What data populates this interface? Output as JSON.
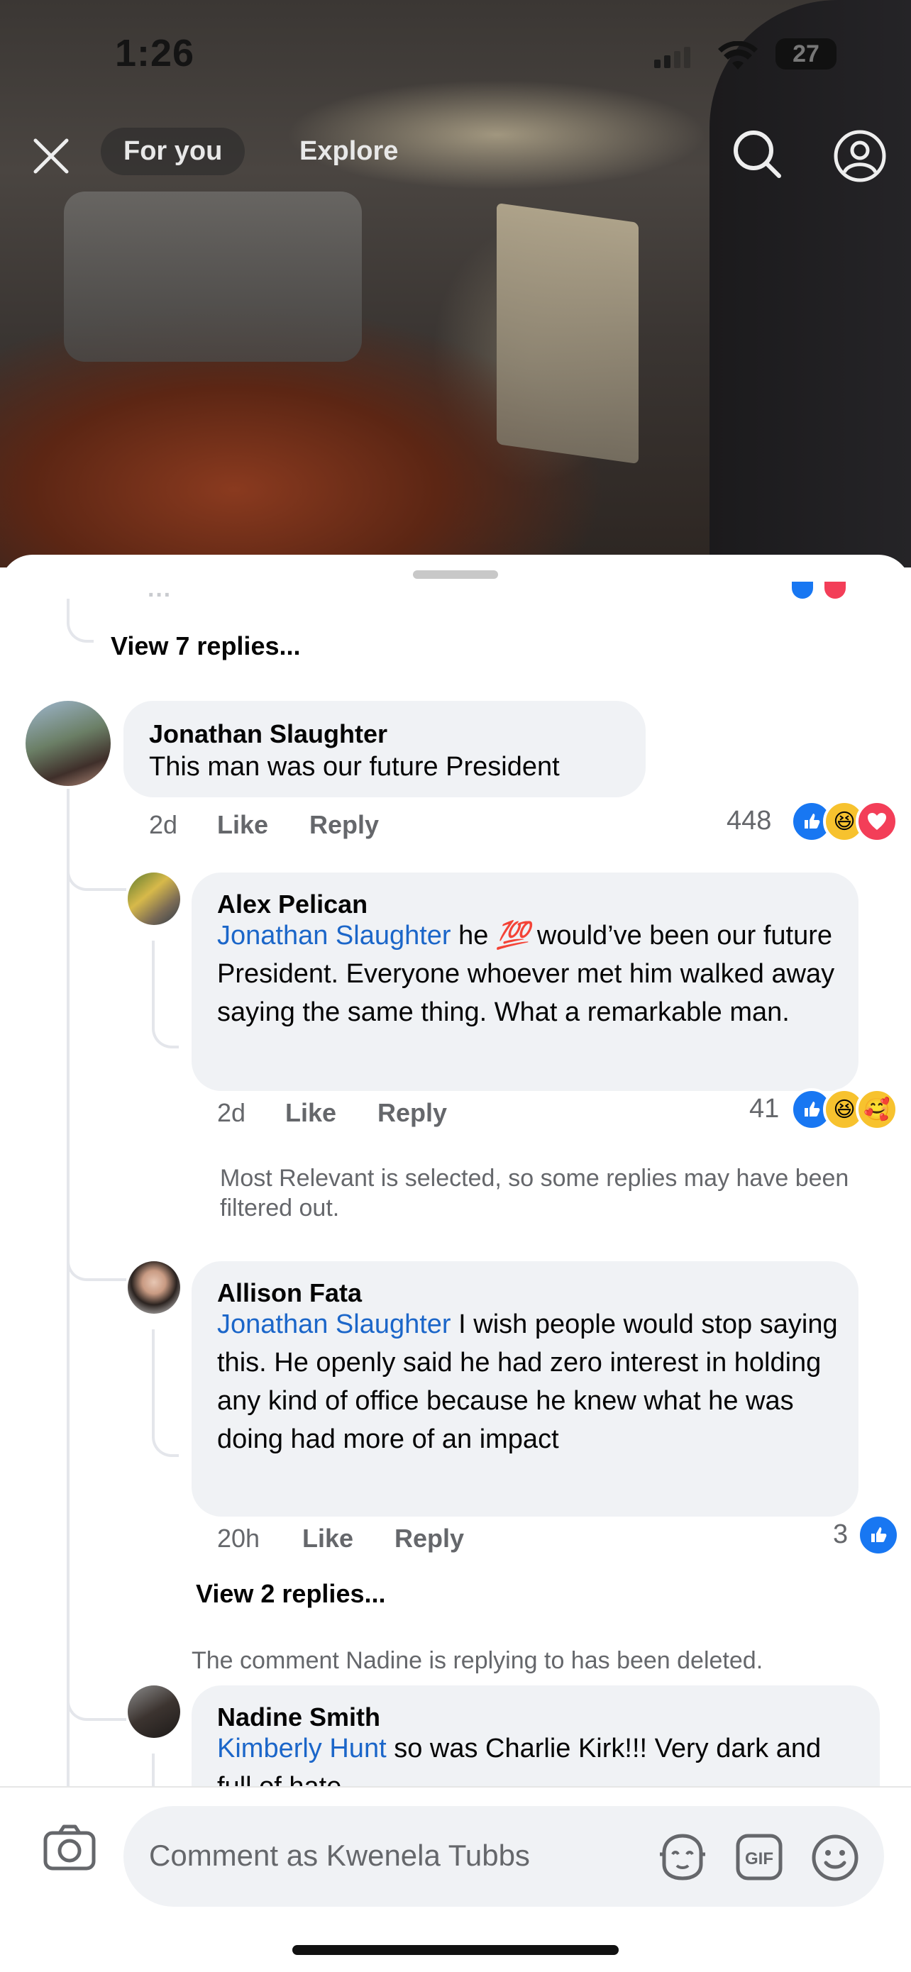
{
  "status_bar": {
    "time": "1:26",
    "battery": "27"
  },
  "top_nav": {
    "tab_for_you": "For you",
    "tab_explore": "Explore"
  },
  "comments": {
    "view_replies_top": "View 7 replies...",
    "c1": {
      "author": "Jonathan Slaughter",
      "text": "This man was our future President",
      "time": "2d",
      "like": "Like",
      "reply": "Reply",
      "count": "448"
    },
    "r1": {
      "author": "Alex Pelican",
      "mention": "Jonathan Slaughter",
      "text_a": " he ",
      "emoji": "💯",
      "text_b": " would’ve been our future President. Everyone whoever met him walked away saying the same thing. What a remarkable man.",
      "time": "2d",
      "like": "Like",
      "reply": "Reply",
      "count": "41"
    },
    "filter_note": "Most Relevant is selected, so some replies may have been filtered out.",
    "r2": {
      "author": "Allison Fata",
      "mention": "Jonathan Slaughter",
      "text": " I wish people would stop saying this. He openly said he had zero interest in holding any kind of office because he knew what he was doing had more of an impact",
      "time": "20h",
      "like": "Like",
      "reply": "Reply",
      "count": "3"
    },
    "view_replies_r2": "View 2 replies...",
    "deleted_note": "The comment Nadine is replying to has been deleted.",
    "r3": {
      "author": "Nadine Smith",
      "mention": "Kimberly Hunt",
      "text": " so was Charlie Kirk!!! Very dark and full of hate"
    }
  },
  "composer": {
    "placeholder": "Comment as Kwenela Tubbs"
  },
  "colors": {
    "link": "#1b66c9",
    "like_blue": "#1877f2",
    "bubble": "#f0f2f5"
  },
  "icons": [
    "close-icon",
    "search-icon",
    "profile-icon",
    "camera-icon",
    "avatar-sticker-icon",
    "gif-icon",
    "emoji-icon"
  ]
}
